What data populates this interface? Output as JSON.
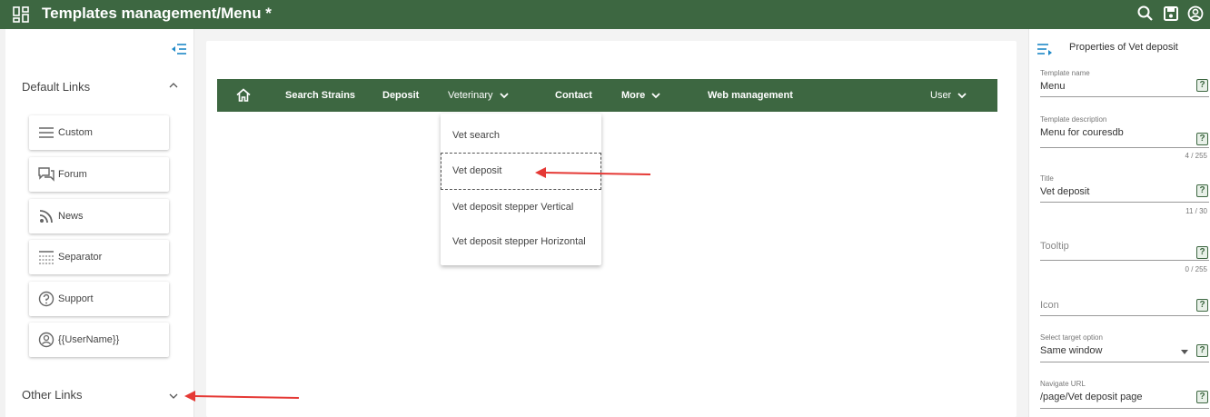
{
  "header": {
    "title": "Templates management/Menu *",
    "icons": [
      "dashboard-icon",
      "search-icon",
      "save-icon",
      "account-icon"
    ],
    "background": "#3d6741"
  },
  "left_panel": {
    "sections": [
      {
        "label": "Default Links",
        "expanded": true
      },
      {
        "label": "Other Links",
        "expanded": false
      }
    ],
    "links": [
      {
        "label": "Custom",
        "icon": "lines-icon"
      },
      {
        "label": "Forum",
        "icon": "forum-icon"
      },
      {
        "label": "News",
        "icon": "rss-icon"
      },
      {
        "label": "Separator",
        "icon": "separator-icon"
      },
      {
        "label": "Support",
        "icon": "help-circle-icon"
      },
      {
        "label": "{{UserName}}",
        "icon": "user-circle-icon"
      }
    ]
  },
  "menu_preview": {
    "items": [
      {
        "label": "Search Strains",
        "dropdown": false
      },
      {
        "label": "Deposit",
        "dropdown": false
      },
      {
        "label": "Veterinary",
        "dropdown": true
      },
      {
        "label": "Contact",
        "dropdown": false
      },
      {
        "label": "More",
        "dropdown": true
      },
      {
        "label": "Web management",
        "dropdown": false
      },
      {
        "label": "User",
        "dropdown": true
      }
    ],
    "dropdown_items": [
      "Vet search",
      "Vet deposit",
      "Vet deposit stepper Vertical",
      "Vet deposit stepper Horizontal"
    ],
    "selected_item": "Vet deposit"
  },
  "properties": {
    "title": "Properties of Vet deposit",
    "fields": {
      "template_name": {
        "label": "Template name",
        "value": "Menu"
      },
      "template_description": {
        "label": "Template description",
        "value": "Menu for couresdb",
        "counter": "4 / 255"
      },
      "title": {
        "label": "Title",
        "value": "Vet deposit",
        "counter": "11 / 30"
      },
      "tooltip": {
        "placeholder": "Tooltip",
        "counter": "0 / 255"
      },
      "icon": {
        "placeholder": "Icon"
      },
      "target": {
        "label": "Select target option",
        "value": "Same window"
      },
      "url": {
        "label": "Navigate URL",
        "value": "/page/Vet deposit page"
      }
    },
    "help_glyph": "?"
  },
  "annotation_color": "#e53935"
}
